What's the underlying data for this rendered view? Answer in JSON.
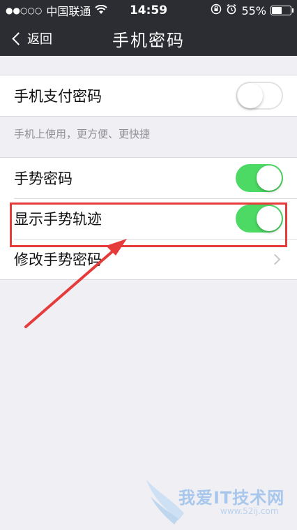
{
  "status_bar": {
    "carrier": "中国联通",
    "time": "14:59",
    "battery_percent": "55%",
    "battery_level": 0.55
  },
  "nav": {
    "back_label": "返回",
    "title": "手机密码"
  },
  "payment_section": {
    "label": "手机支付密码",
    "enabled": false,
    "hint": "手机上使用，更方便、更快捷"
  },
  "gesture_section": {
    "items": [
      {
        "label": "手势密码",
        "type": "toggle",
        "enabled": true
      },
      {
        "label": "显示手势轨迹",
        "type": "toggle",
        "enabled": true
      },
      {
        "label": "修改手势密码",
        "type": "link"
      }
    ]
  },
  "colors": {
    "nav_bg": "#2b2d33",
    "toggle_on": "#4cd964",
    "highlight": "#e53b3b"
  },
  "watermark": {
    "text": "我爱IT技术网",
    "url": "www.52ij.com"
  }
}
